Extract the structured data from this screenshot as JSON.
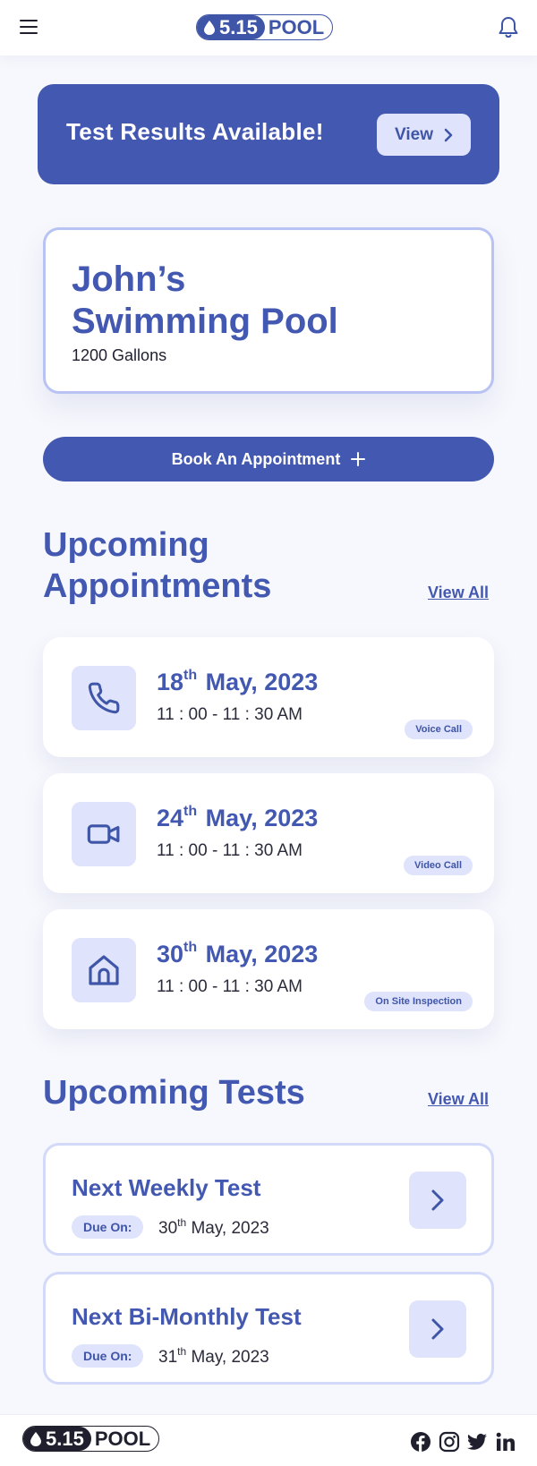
{
  "header": {
    "logo_number": "5.15",
    "logo_word": "POOL"
  },
  "banner": {
    "title": "Test Results Available!",
    "view_label": "View"
  },
  "pool": {
    "name_line1": "John’s",
    "name_line2": "Swimming Pool",
    "gallons": "1200 Gallons"
  },
  "book_button": {
    "label": "Book An Appointment"
  },
  "appointments": {
    "title_line1": "Upcoming",
    "title_line2": "Appointments",
    "view_all": "View All",
    "items": [
      {
        "day": "18",
        "suffix": "th",
        "month_year": "May, 2023",
        "time": "11 : 00 - 11 : 30 AM",
        "type": "Voice Call",
        "icon": "phone-icon"
      },
      {
        "day": "24",
        "suffix": "th",
        "month_year": "May, 2023",
        "time": "11 : 00 - 11 : 30 AM",
        "type": "Video Call",
        "icon": "video-camera-icon"
      },
      {
        "day": "30",
        "suffix": "th",
        "month_year": "May, 2023",
        "time": "11 : 00 - 11 : 30 AM",
        "type": "On Site Inspection",
        "icon": "house-icon"
      }
    ]
  },
  "tests": {
    "title": "Upcoming Tests",
    "view_all": "View All",
    "items": [
      {
        "title": "Next Weekly Test",
        "due_label": "Due On:",
        "day": "30",
        "suffix": "th",
        "month_year": "May, 2023"
      },
      {
        "title": "Next Bi-Monthly Test",
        "due_label": "Due On:",
        "day": "31",
        "suffix": "th",
        "month_year": "May, 2023"
      }
    ]
  },
  "footer": {
    "logo_number": "5.15",
    "logo_word": "POOL",
    "social": [
      "facebook-icon",
      "instagram-icon",
      "twitter-icon",
      "linkedin-icon"
    ]
  },
  "colors": {
    "primary": "#4358b0",
    "accent_light": "#dfe3fb",
    "card_border": "#b9c3f3"
  }
}
